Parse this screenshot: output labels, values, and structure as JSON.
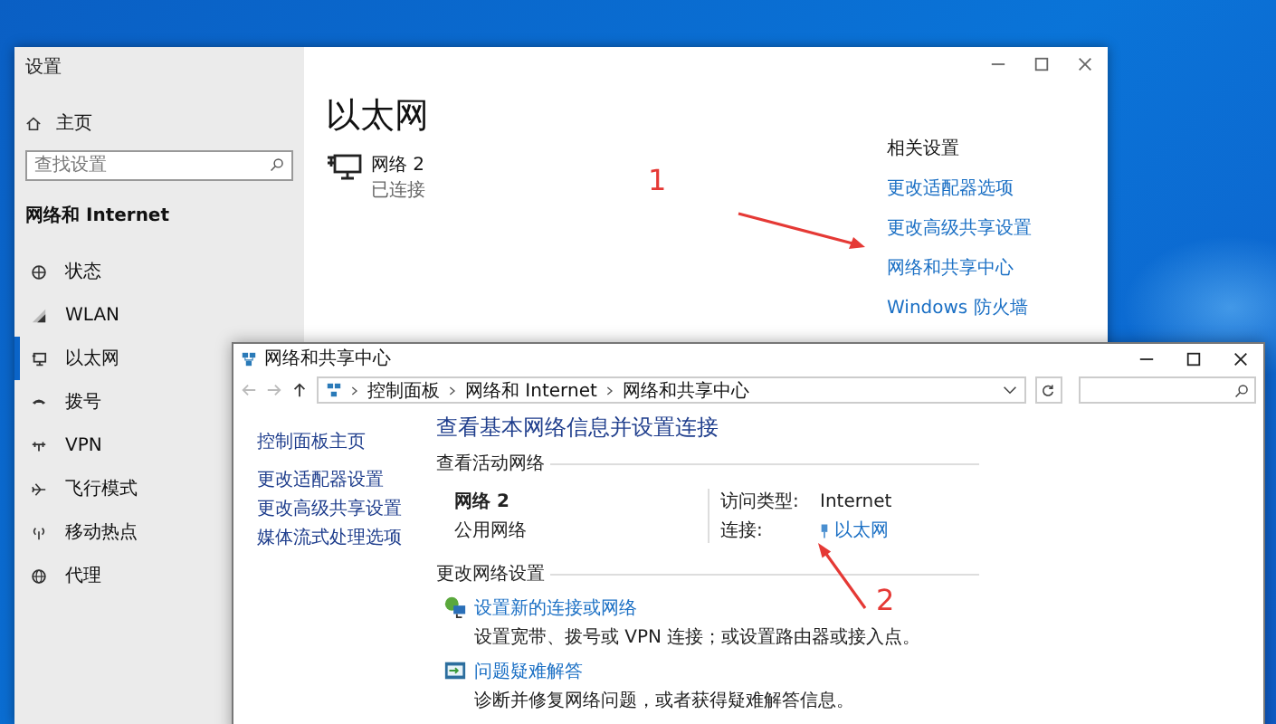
{
  "settings_window": {
    "title": "设置",
    "home": "主页",
    "search": {
      "placeholder": "查找设置"
    },
    "section": "网络和 Internet",
    "nav": [
      {
        "label": "状态",
        "kind": "status",
        "selected": false
      },
      {
        "label": "WLAN",
        "kind": "wifi",
        "selected": false
      },
      {
        "label": "以太网",
        "kind": "ethernet",
        "selected": true
      },
      {
        "label": "拨号",
        "kind": "dialup",
        "selected": false
      },
      {
        "label": "VPN",
        "kind": "vpn",
        "selected": false
      },
      {
        "label": "飞行模式",
        "kind": "airplane",
        "selected": false
      },
      {
        "label": "移动热点",
        "kind": "hotspot",
        "selected": false
      },
      {
        "label": "代理",
        "kind": "proxy",
        "selected": false
      }
    ],
    "page_title": "以太网",
    "network": {
      "name": "网络 2",
      "status": "已连接"
    },
    "related": {
      "heading": "相关设置",
      "links": [
        "更改适配器选项",
        "更改高级共享设置",
        "网络和共享中心",
        "Windows 防火墙"
      ]
    }
  },
  "control_panel_window": {
    "title": "网络和共享中心",
    "breadcrumb": [
      "控制面板",
      "网络和 Internet",
      "网络和共享中心"
    ],
    "sidebar_links": [
      {
        "label": "控制面板主页",
        "kind": "home"
      },
      {
        "label": "更改适配器设置",
        "kind": "task"
      },
      {
        "label": "更改高级共享设置",
        "kind": "task"
      },
      {
        "label": "媒体流式处理选项",
        "kind": "task"
      }
    ],
    "heading": "查看基本网络信息并设置连接",
    "active_networks_label": "查看活动网络",
    "network": {
      "name": "网络 2",
      "type": "公用网络",
      "access_label": "访问类型:",
      "access_value": "Internet",
      "connection_label": "连接:",
      "connection_value": "以太网"
    },
    "change_label": "更改网络设置",
    "tasks": [
      {
        "kind": "setup",
        "link": "设置新的连接或网络",
        "description": "设置宽带、拨号或 VPN 连接；或设置路由器或接入点。"
      },
      {
        "kind": "troubleshoot",
        "link": "问题疑难解答",
        "description": "诊断并修复网络问题，或者获得疑难解答信息。"
      }
    ]
  },
  "annotations": [
    {
      "label": "1"
    },
    {
      "label": "2"
    }
  ]
}
